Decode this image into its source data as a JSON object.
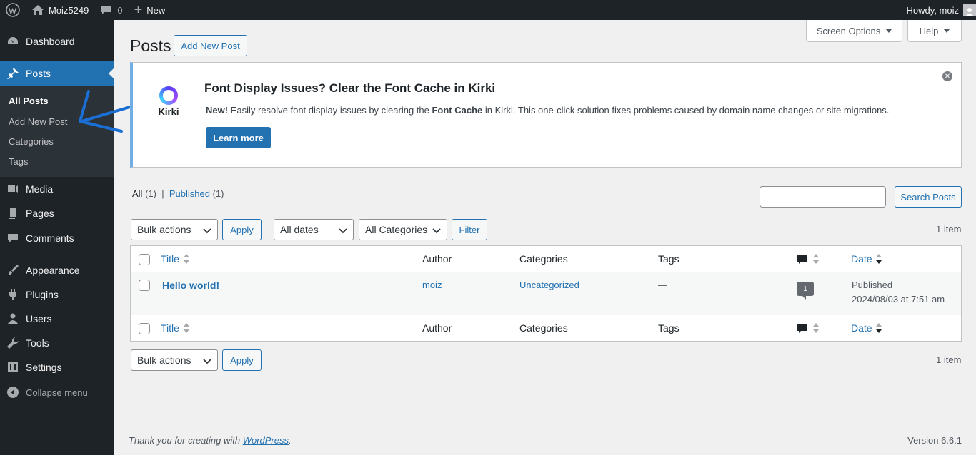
{
  "adminbar": {
    "site_name": "Moiz5249",
    "comments_count": "0",
    "new_label": "New",
    "howdy": "Howdy, moiz"
  },
  "sidebar": {
    "items": [
      {
        "label": "Dashboard",
        "icon": "dashboard-icon"
      },
      {
        "label": "Posts",
        "icon": "pin-icon"
      },
      {
        "label": "Media",
        "icon": "media-icon"
      },
      {
        "label": "Pages",
        "icon": "pages-icon"
      },
      {
        "label": "Comments",
        "icon": "comment-icon"
      },
      {
        "label": "Appearance",
        "icon": "brush-icon"
      },
      {
        "label": "Plugins",
        "icon": "plugin-icon"
      },
      {
        "label": "Users",
        "icon": "users-icon"
      },
      {
        "label": "Tools",
        "icon": "wrench-icon"
      },
      {
        "label": "Settings",
        "icon": "settings-icon"
      }
    ],
    "submenu": [
      "All Posts",
      "Add New Post",
      "Categories",
      "Tags"
    ],
    "collapse": "Collapse menu"
  },
  "header": {
    "title": "Posts",
    "add_new": "Add New Post",
    "screen_options": "Screen Options",
    "help": "Help"
  },
  "notice": {
    "logo_text": "Kirki",
    "title": "Font Display Issues? Clear the Font Cache in Kirki",
    "new": "New!",
    "text1": " Easily resolve font display issues by clearing the ",
    "font_cache": "Font Cache",
    "text2": " in Kirki. This one-click solution fixes problems caused by domain name changes or site migrations.",
    "button": "Learn more"
  },
  "views": {
    "all": "All",
    "all_count": "(1)",
    "sep": "|",
    "published": "Published",
    "published_count": "(1)"
  },
  "search": {
    "button": "Search Posts"
  },
  "filters": {
    "bulk": "Bulk actions",
    "apply": "Apply",
    "dates": "All dates",
    "categories": "All Categories",
    "filter": "Filter",
    "count": "1 item"
  },
  "table": {
    "columns": {
      "title": "Title",
      "author": "Author",
      "categories": "Categories",
      "tags": "Tags",
      "date": "Date"
    },
    "rows": [
      {
        "title": "Hello world!",
        "author": "moiz",
        "categories": "Uncategorized",
        "tags": "—",
        "comments": "1",
        "status": "Published",
        "date": "2024/08/03 at 7:51 am"
      }
    ]
  },
  "footer": {
    "thanks_pre": "Thank you for creating with ",
    "thanks_link": "WordPress",
    "thanks_post": ".",
    "version": "Version 6.6.1"
  },
  "colors": {
    "accent": "#2271b1",
    "sidebar": "#1d2327",
    "annotation_arrow": "#1a6fd6"
  }
}
